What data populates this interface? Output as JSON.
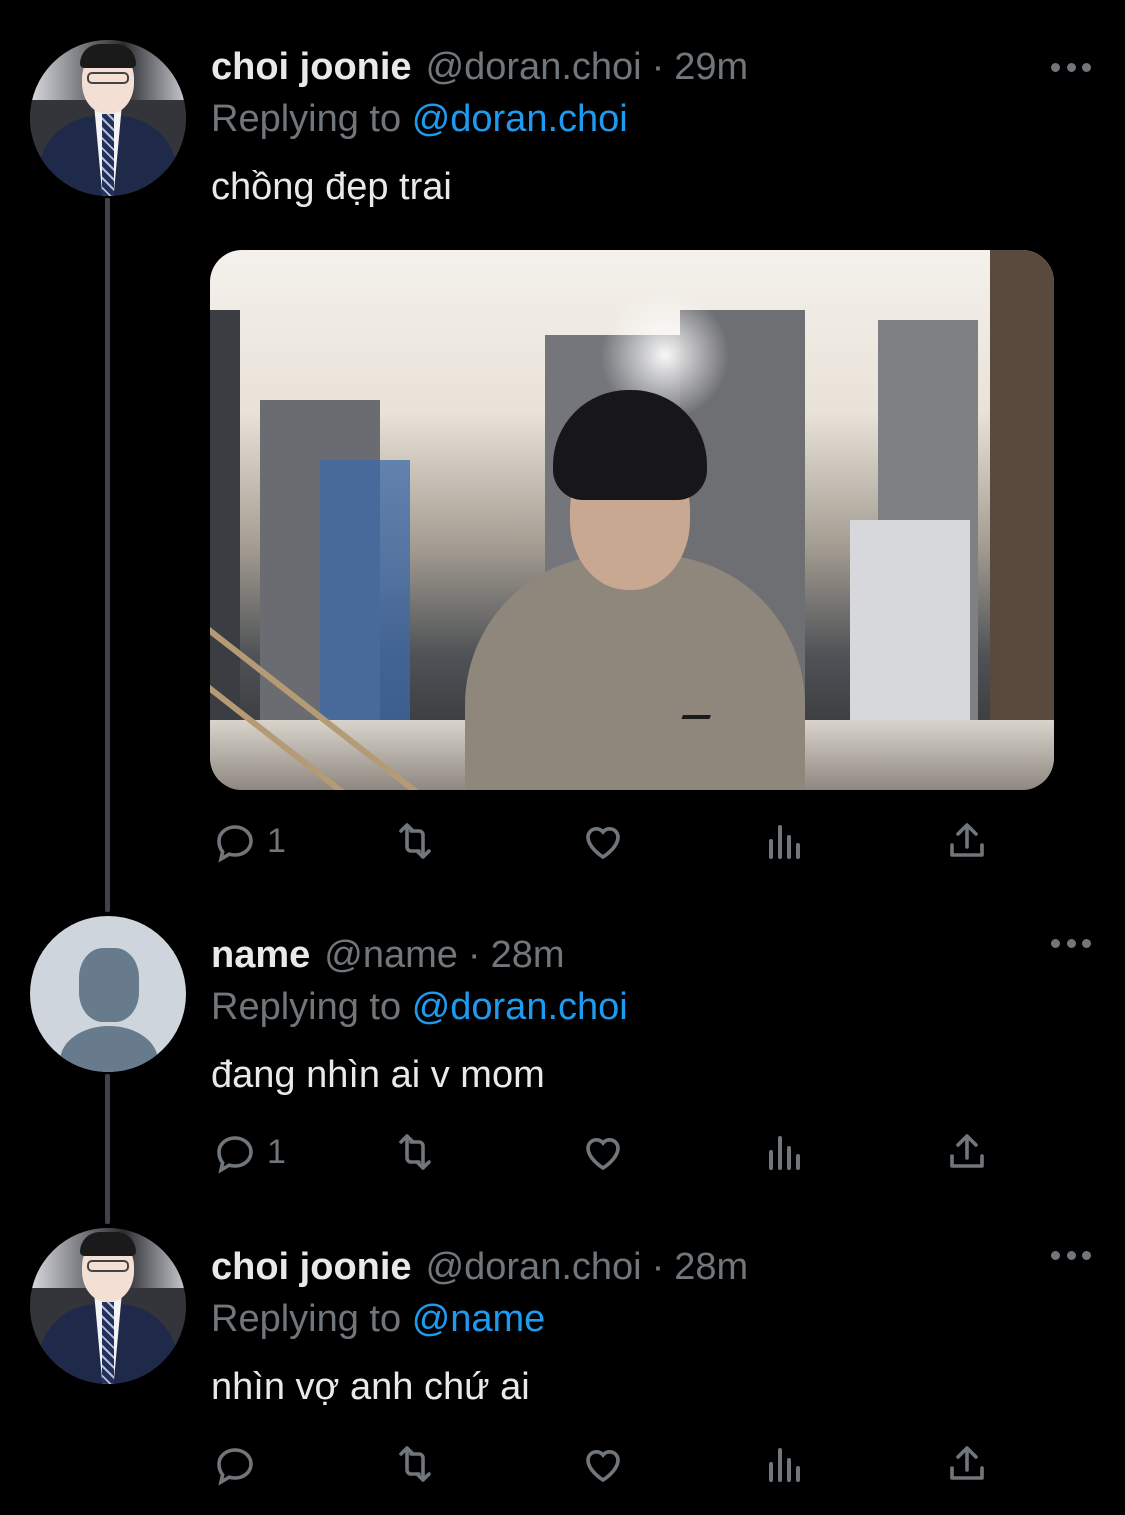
{
  "tweets": [
    {
      "display_name": "choi joonie",
      "handle": "@doran.choi",
      "separator": "·",
      "time": "29m",
      "replying_prefix": "Replying to",
      "replying_to": "@doran.choi",
      "text": "chồng đẹp trai",
      "has_media": true,
      "reply_count": "1",
      "avatar": "photo"
    },
    {
      "display_name": "name",
      "handle": "@name",
      "separator": "·",
      "time": "28m",
      "replying_prefix": "Replying to",
      "replying_to": "@doran.choi",
      "text": "đang nhìn ai v mom",
      "has_media": false,
      "reply_count": "1",
      "avatar": "default"
    },
    {
      "display_name": "choi joonie",
      "handle": "@doran.choi",
      "separator": "·",
      "time": "28m",
      "replying_prefix": "Replying to",
      "replying_to": "@name",
      "text": "nhìn vợ anh chứ ai",
      "has_media": false,
      "reply_count": "",
      "avatar": "photo"
    }
  ],
  "icons": {
    "reply": "reply-icon",
    "retweet": "retweet-icon",
    "like": "heart-icon",
    "views": "views-icon",
    "share": "share-icon",
    "more": "more-icon"
  },
  "colors": {
    "background": "#000000",
    "text": "#e7e9ea",
    "secondary": "#71767b",
    "link": "#1d9bf0",
    "thread_line": "#3f4349"
  }
}
